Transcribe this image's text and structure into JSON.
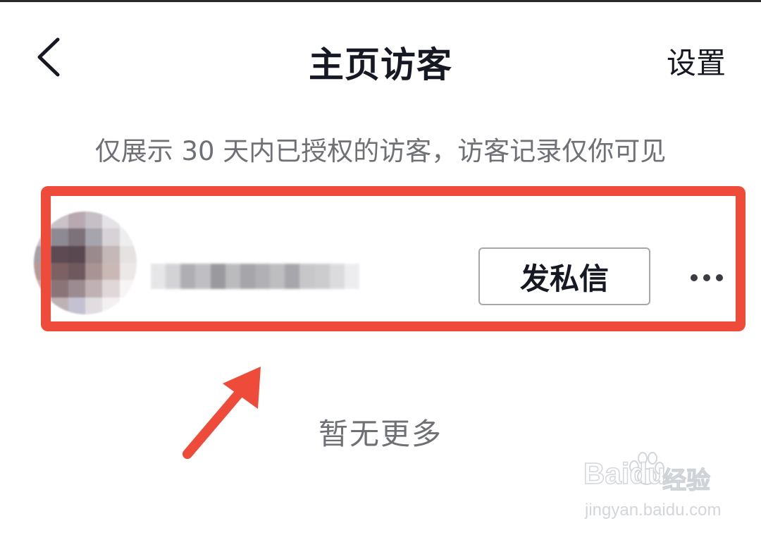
{
  "header": {
    "title": "主页访客",
    "settings_label": "设置"
  },
  "notice": "仅展示 30 天内已授权的访客，访客记录仅你可见",
  "visitor": {
    "message_button_label": "发私信"
  },
  "empty_state": "暂无更多",
  "watermark": {
    "brand": "Baidu",
    "brand_cn": "经验",
    "url": "jingyan.baidu.com"
  },
  "colors": {
    "highlight": "#ee4b3a",
    "title_text": "#161823",
    "muted_text": "#6f7076"
  },
  "icons": {
    "back": "chevron-left-icon",
    "more": "ellipsis-icon",
    "arrow": "annotation-arrow-icon"
  }
}
